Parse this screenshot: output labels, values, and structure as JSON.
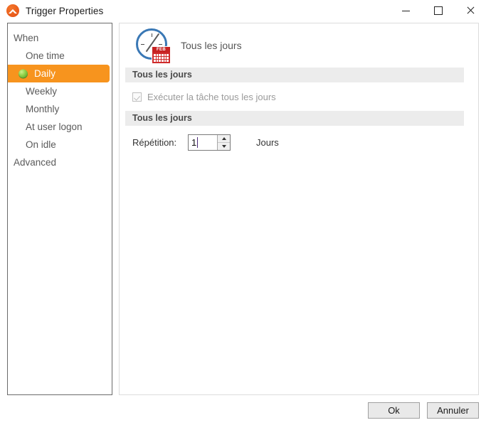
{
  "window": {
    "title": "Trigger Properties",
    "app_icon": "app-logo-icon",
    "controls": {
      "minimize": "minimize-icon",
      "maximize": "maximize-icon",
      "close": "close-icon"
    }
  },
  "sidebar": {
    "groups": [
      {
        "label": "When",
        "items": [
          {
            "label": "One time",
            "selected": false
          },
          {
            "label": "Daily",
            "selected": true,
            "icon": "green-sphere-icon"
          },
          {
            "label": "Weekly",
            "selected": false
          },
          {
            "label": "Monthly",
            "selected": false
          },
          {
            "label": "At user logon",
            "selected": false
          },
          {
            "label": "On idle",
            "selected": false
          }
        ]
      },
      {
        "label": "Advanced",
        "items": []
      }
    ]
  },
  "panel": {
    "header": {
      "icon": "clock-calendar-icon",
      "calendar_month": "FEB",
      "title": "Tous les jours"
    },
    "sections": [
      {
        "header": "Tous les jours",
        "checkbox": {
          "label": "Exécuter la tâche tous les jours",
          "checked": true,
          "disabled": true
        }
      },
      {
        "header": "Tous les jours",
        "field": {
          "label": "Répétition:",
          "value": "1",
          "unit": "Jours"
        }
      }
    ]
  },
  "footer": {
    "ok_label": "Ok",
    "cancel_label": "Annuler"
  },
  "colors": {
    "accent": "#f7941e",
    "section_bar": "#ececec",
    "clock_blue": "#3a78b5",
    "calendar_red": "#cf2b2b"
  }
}
